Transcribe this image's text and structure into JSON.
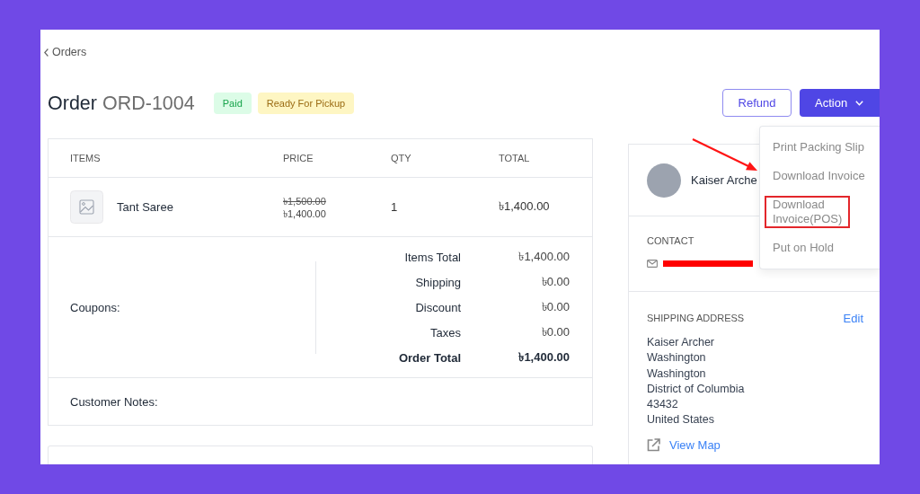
{
  "back_link": {
    "label": "Orders"
  },
  "header": {
    "title": "Order",
    "order_number": "ORD-1004",
    "badges": [
      {
        "label": "Paid",
        "kind": "success"
      },
      {
        "label": "Ready For Pickup",
        "kind": "warning"
      }
    ]
  },
  "actions": {
    "refund": {
      "label": "Refund"
    },
    "action": {
      "label": "Action",
      "expanded": true,
      "menu": [
        {
          "label": "Print Packing Slip",
          "highlighted": false
        },
        {
          "label": "Download Invoice",
          "highlighted": false
        },
        {
          "label": "Download Invoice(POS)",
          "highlighted": true
        },
        {
          "label": "Put on Hold",
          "highlighted": false
        }
      ]
    }
  },
  "items_table": {
    "columns": [
      "ITEMS",
      "PRICE",
      "QTY",
      "TOTAL"
    ],
    "rows": [
      {
        "name": "Tant Saree",
        "original_price": "৳1,500.00",
        "price": "৳1,400.00",
        "qty": "1",
        "total": "৳1,400.00"
      }
    ]
  },
  "coupons": {
    "label": "Coupons:"
  },
  "summary": [
    {
      "label": "Items Total",
      "value": "৳1,400.00",
      "kind": "line"
    },
    {
      "label": "Shipping",
      "value": "৳0.00",
      "kind": "line"
    },
    {
      "label": "Discount",
      "value": "৳0.00",
      "kind": "line"
    },
    {
      "label": "Taxes",
      "value": "৳0.00",
      "kind": "line"
    },
    {
      "label": "Order Total",
      "value": "৳1,400.00",
      "kind": "total"
    }
  ],
  "customer_notes": {
    "label": "Customer Notes:"
  },
  "customer": {
    "name": "Kaiser Arche"
  },
  "contact": {
    "heading": "CONTACT"
  },
  "shipping_address": {
    "heading": "SHIPPING ADDRESS",
    "edit_label": "Edit",
    "lines": [
      "Kaiser Archer",
      "Washington",
      "Washington",
      "District of Columbia",
      "43432",
      "United States"
    ],
    "map_link": "View Map"
  }
}
